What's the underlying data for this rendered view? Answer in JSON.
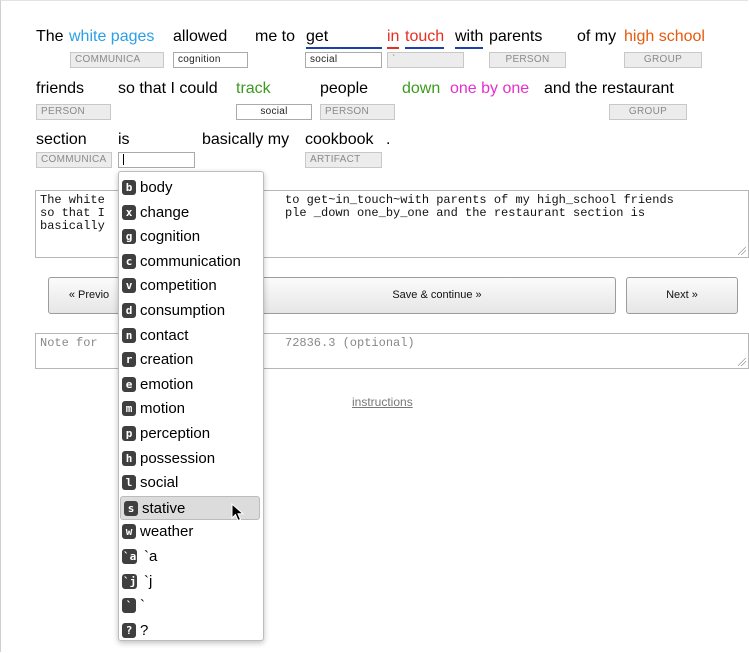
{
  "sentence": {
    "line1": [
      "The",
      "white pages",
      "allowed",
      "me to",
      "get",
      "in",
      "touch",
      "with",
      "parents",
      "of my",
      "high school"
    ],
    "line2": [
      "friends",
      "so that I could",
      "track",
      "people",
      "down",
      "one by one",
      "and the restaurant"
    ],
    "line3": [
      "section",
      "is",
      "basically my",
      "cookbook",
      "."
    ]
  },
  "tags": {
    "communica1": "COMMUNICA",
    "cognition": "cognition",
    "social1": "social",
    "backtick": "`",
    "person1": "PERSON",
    "group1": "GROUP",
    "person2": "PERSON",
    "social2": "social",
    "person3": "PERSON",
    "group2": "GROUP",
    "communica2": "COMMUNICA",
    "artifact": "ARTIFACT"
  },
  "annotation_text": "The white pages allowed me to get~in_touch~with parents of my high_school friends\nso that I could track people _down one_by_one and the restaurant section is\nbasically my cookbook .",
  "annotation_visible": {
    "l1a": "The white",
    "l1b": "to get~in_touch~with parents of my high_school friends",
    "l2a": "so that I",
    "l2b": "ple _down one_by_one and the restaurant section is",
    "l3a": "basically"
  },
  "buttons": {
    "previous": "« Previo",
    "save": "Save & continue »",
    "next": "Next »"
  },
  "note": {
    "left": "Note for",
    "right": "72836.3 (optional)"
  },
  "instructions_link": "instructions",
  "dropdown": {
    "items": [
      {
        "key": "b",
        "label": "body"
      },
      {
        "key": "x",
        "label": "change"
      },
      {
        "key": "g",
        "label": "cognition"
      },
      {
        "key": "c",
        "label": "communication"
      },
      {
        "key": "v",
        "label": "competition"
      },
      {
        "key": "d",
        "label": "consumption"
      },
      {
        "key": "n",
        "label": "contact"
      },
      {
        "key": "r",
        "label": "creation"
      },
      {
        "key": "e",
        "label": "emotion"
      },
      {
        "key": "m",
        "label": "motion"
      },
      {
        "key": "p",
        "label": "perception"
      },
      {
        "key": "h",
        "label": "possession"
      },
      {
        "key": "l",
        "label": "social"
      },
      {
        "key": "s",
        "label": "stative"
      },
      {
        "key": "w",
        "label": "weather"
      },
      {
        "key": "`a",
        "label": "`a"
      },
      {
        "key": "`j",
        "label": "`j"
      },
      {
        "key": "`",
        "label": "`"
      },
      {
        "key": "?",
        "label": "?"
      }
    ],
    "selected": "stative"
  }
}
